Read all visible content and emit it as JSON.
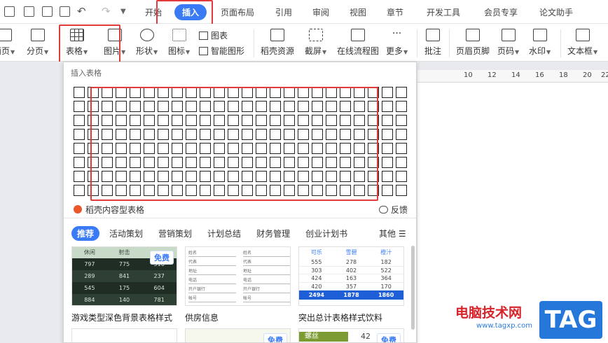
{
  "quick_access": {
    "icons": [
      "save-icon",
      "export-pdf-icon",
      "print-icon",
      "print-preview-icon",
      "undo-icon",
      "redo-icon",
      "customize-dropdown-icon"
    ]
  },
  "menu": {
    "tabs": [
      {
        "id": "home",
        "label": "开始"
      },
      {
        "id": "insert",
        "label": "插入"
      },
      {
        "id": "page-layout",
        "label": "页面布局"
      },
      {
        "id": "references",
        "label": "引用"
      },
      {
        "id": "review",
        "label": "审阅"
      },
      {
        "id": "view",
        "label": "视图"
      },
      {
        "id": "section",
        "label": "章节"
      },
      {
        "id": "developer",
        "label": "开发工具"
      },
      {
        "id": "member",
        "label": "会员专享"
      },
      {
        "id": "paper",
        "label": "论文助手"
      }
    ],
    "active": "插入"
  },
  "ribbon": {
    "cover_page": "封面页",
    "page_break": "分页",
    "table": "表格",
    "picture": "图片",
    "shape": "形状",
    "icon": "图标",
    "chart": "图表",
    "smart_art": "智能图形",
    "docer_resources": "稻壳资源",
    "screenshot": "截屏",
    "online_flowchart": "在线流程图",
    "more": "更多",
    "comment": "批注",
    "header_footer": "页眉页脚",
    "page_number": "页码",
    "watermark": "水印",
    "text_box": "文本框"
  },
  "ruler": {
    "ticks": [
      "10",
      "12",
      "14",
      "16",
      "18",
      "20",
      "22"
    ]
  },
  "insert_table_panel": {
    "title": "插入表格",
    "grid": {
      "cols": 24,
      "rows": 8,
      "highlight_cols": 20,
      "highlight_rows": 8
    },
    "content_tables_label": "稻壳内容型表格",
    "feedback_label": "反馈",
    "categories": [
      "推荐",
      "活动策划",
      "营销策划",
      "计划总结",
      "财务管理",
      "创业计划书"
    ],
    "active_category": "推荐",
    "more_label": "其他",
    "templates": [
      {
        "name": "游戏类型深色背景表格样式",
        "badge": "免费",
        "headers": [
          "休闲",
          "射击",
          ""
        ],
        "rows": [
          [
            "797",
            "775",
            "516"
          ],
          [
            "289",
            "841",
            "237"
          ],
          [
            "545",
            "175",
            "604"
          ],
          [
            "884",
            "140",
            "781"
          ]
        ]
      },
      {
        "name": "供房信息",
        "badge": "",
        "fields_left": [
          "姓名",
          "代表",
          "地址",
          "电话",
          "开户银行",
          "帐号"
        ],
        "fields_right": [
          "姓名",
          "代表",
          "地址",
          "电话",
          "开户银行",
          "帐号"
        ]
      },
      {
        "name": "突出总计表格样式饮料",
        "badge": "",
        "headers": [
          "可乐",
          "雪碧",
          "橙汁"
        ],
        "rows": [
          [
            "555",
            "278",
            "182"
          ],
          [
            "303",
            "402",
            "522"
          ],
          [
            "424",
            "163",
            "364"
          ],
          [
            "420",
            "357",
            "170"
          ]
        ],
        "total": [
          "2494",
          "1878",
          "1860"
        ]
      }
    ],
    "bottom_templates": [
      {
        "badge": ""
      },
      {
        "badge": "免费"
      },
      {
        "badge": "免费",
        "label": "螺丝",
        "value": "42"
      }
    ]
  },
  "watermark": {
    "site_name": "电脑技术网",
    "url": "www.tagxp.com",
    "tag": "TAG"
  },
  "colors": {
    "accent": "#3a7bf5",
    "highlight_border": "#e23b3b",
    "dark_template": "#1f2d24",
    "total_row": "#1e5fd8"
  }
}
